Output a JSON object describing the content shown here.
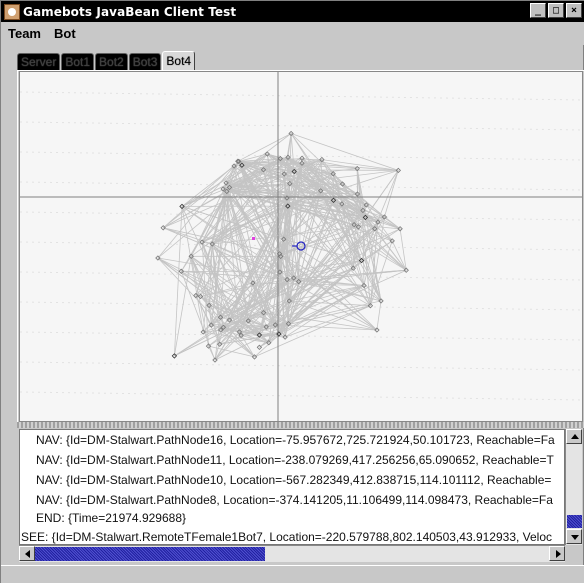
{
  "window": {
    "title": "Gamebots JavaBean Client Test",
    "controls": {
      "minimize": "_",
      "maximize": "□",
      "close": "×"
    }
  },
  "menubar": {
    "items": [
      {
        "label": "Team"
      },
      {
        "label": "Bot"
      }
    ]
  },
  "tabs": {
    "items": [
      {
        "label": "Server",
        "active": false
      },
      {
        "label": "Bot1",
        "active": false
      },
      {
        "label": "Bot2",
        "active": false
      },
      {
        "label": "Bot3",
        "active": false
      },
      {
        "label": "Bot4",
        "active": true
      }
    ]
  },
  "map": {
    "background": "#f6f6f6",
    "path_color": "#c4c4c4",
    "crosshair_color": "#808080",
    "bot_marker_color": "#2020c0",
    "highlight_node_color": "#e040e0"
  },
  "log": {
    "lines": [
      "NAV: {Id=DM-Stalwart.PathNode16, Location=-75.957672,725.721924,50.101723, Reachable=Fa",
      "NAV: {Id=DM-Stalwart.PathNode11, Location=-238.079269,417.256256,65.090652, Reachable=T",
      "NAV: {Id=DM-Stalwart.PathNode10, Location=-567.282349,412.838715,114.101112, Reachable=",
      "NAV: {Id=DM-Stalwart.PathNode8, Location=-374.141205,11.106499,114.098473, Reachable=Fa",
      "END: {Time=21974.929688}",
      "SEE: {Id=DM-Stalwart.RemoteTFemale1Bot7, Location=-220.579788,802.140503,43.912933, Veloc"
    ]
  },
  "scrollbars": {
    "vertical_position": 0.85,
    "horizontal_position": 0.0
  }
}
